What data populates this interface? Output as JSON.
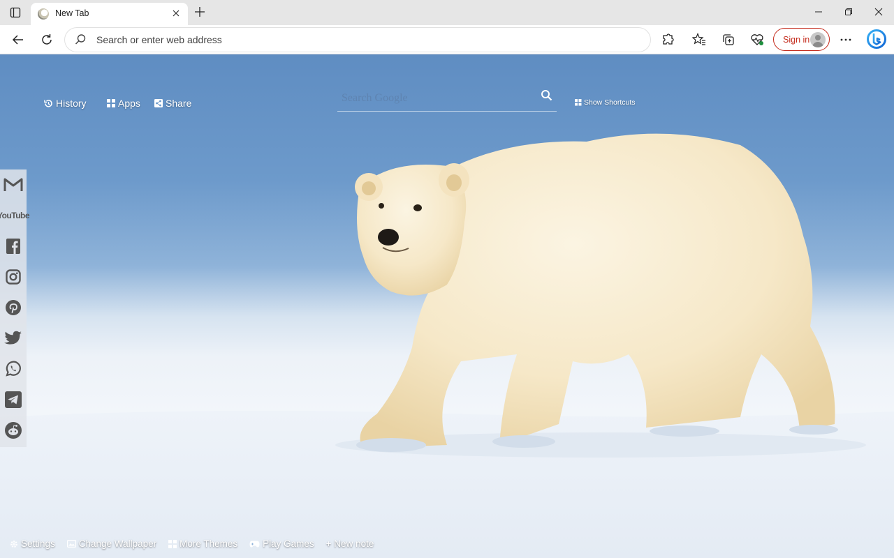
{
  "browser": {
    "tab": {
      "title": "New Tab"
    },
    "address_bar": {
      "placeholder": "Search or enter web address"
    },
    "sign_in_label": "Sign in"
  },
  "newtab": {
    "nav": [
      {
        "label": "History",
        "icon": "history-icon"
      },
      {
        "label": "Apps",
        "icon": "apps-grid-icon"
      },
      {
        "label": "Share",
        "icon": "share-icon"
      }
    ],
    "search": {
      "placeholder": "Search Google",
      "icon": "search-icon"
    },
    "show_shortcuts_label": "Show Shortcuts",
    "social_sidebar": [
      "gmail-icon",
      "youtube-icon",
      "facebook-icon",
      "instagram-icon",
      "pinterest-icon",
      "twitter-icon",
      "whatsapp-icon",
      "telegram-icon",
      "reddit-icon"
    ],
    "youtube_text": "YouTube",
    "bottom_bar": [
      {
        "label": "Settings",
        "icon": "gear-icon"
      },
      {
        "label": "Change Wallpaper",
        "icon": "wallpaper-icon"
      },
      {
        "label": "More Themes",
        "icon": "themes-grid-icon"
      },
      {
        "label": "Play Games",
        "icon": "gamepad-icon"
      },
      {
        "label": "+ New note",
        "icon": ""
      }
    ]
  },
  "colors": {
    "accent_signin": "#c42b1c",
    "sky": "#5f8dc2",
    "snow": "#f4f7fb",
    "bear_fur": "#f6ead0"
  }
}
